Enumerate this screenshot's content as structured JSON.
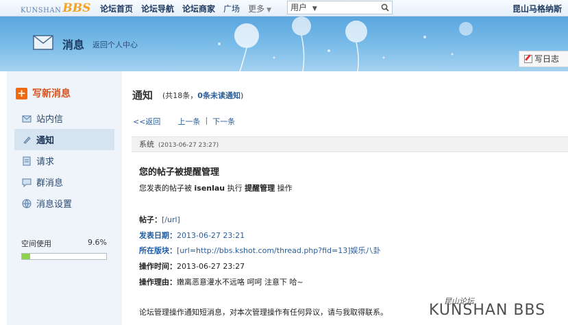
{
  "topbar": {
    "logo_text": "KUNSHAN",
    "logo_bbs": "BBS",
    "nav": [
      "论坛首页",
      "论坛导航",
      "论坛商家",
      "广场",
      "更多"
    ],
    "search_type": "用户",
    "username": "昆山马格纳斯"
  },
  "banner": {
    "title": "消息",
    "back_link": "返回个人中心",
    "write_log": "写日志"
  },
  "sidebar": {
    "compose": "写新消息",
    "items": [
      {
        "label": "站内信",
        "icon": "mail-icon"
      },
      {
        "label": "通知",
        "icon": "pencil-icon",
        "active": true
      },
      {
        "label": "请求",
        "icon": "document-icon"
      },
      {
        "label": "群消息",
        "icon": "chat-icon"
      },
      {
        "label": "消息设置",
        "icon": "globe-icon"
      }
    ],
    "usage_label": "空间使用",
    "usage_percent_text": "9.6%",
    "usage_fraction": 0.096
  },
  "main": {
    "heading": "通知",
    "count_prefix": "(共18条，",
    "count_unread": "0条未读通知",
    "count_suffix": ")",
    "back": "<<返回",
    "prev": "上一条",
    "next": "下一条",
    "sep": "|",
    "sender": "系统",
    "date": "(2013-06-27 23:27)",
    "msg_title": "您的帖子被提醒管理",
    "msg_intro_1": "您发表的帖子被 ",
    "msg_intro_user": "isenlau",
    "msg_intro_2": " 执行 ",
    "msg_intro_action": "提醒管理",
    "msg_intro_3": " 操作",
    "fields": [
      {
        "label": "帖子：",
        "value": "[/url]",
        "label_blue": false,
        "value_link": true
      },
      {
        "label": "发表日期：",
        "value": "2013-06-27 23:21",
        "label_blue": true,
        "value_link": true
      },
      {
        "label": "所在版块：",
        "value": "[url=http://bbs.kshot.com/thread.php?fid=13]娱乐八卦",
        "label_blue": true,
        "value_link": true
      },
      {
        "label": "操作时间：",
        "value": "2013-06-27 23:27",
        "label_blue": false,
        "value_link": false
      },
      {
        "label": "操作理由：",
        "value": "嫩离恶意灌水不远咯 呵呵 注意下 哈~",
        "label_blue": false,
        "value_link": false
      }
    ],
    "footer_note": "论坛管理操作通知短消息，对本次管理操作有任何异议，请与我取得联系。"
  },
  "watermark": {
    "cn": "昆山论坛",
    "en": "KUNSHAN BBS"
  }
}
